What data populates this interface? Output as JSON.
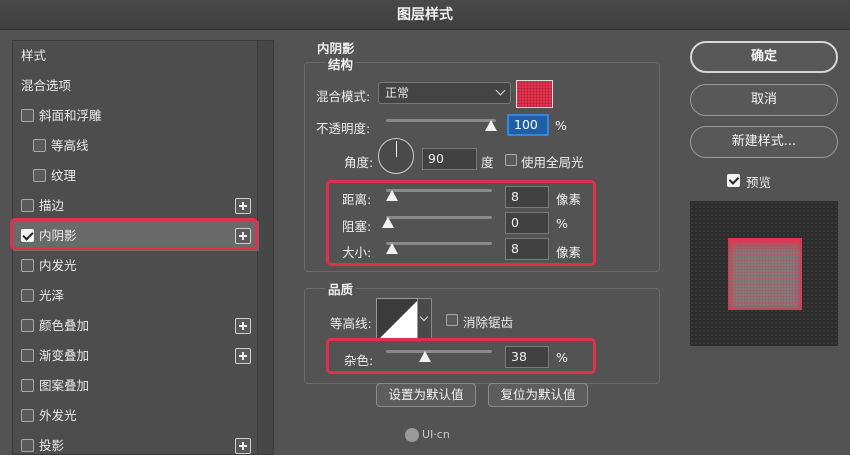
{
  "window": {
    "title": "图层样式"
  },
  "styles_list": {
    "items": [
      {
        "label": "样式",
        "checkbox": false,
        "checked": false,
        "plus": false
      },
      {
        "label": "混合选项",
        "checkbox": false,
        "checked": false,
        "plus": false
      },
      {
        "label": "斜面和浮雕",
        "checkbox": true,
        "checked": false,
        "plus": false
      },
      {
        "label": "等高线",
        "checkbox": true,
        "checked": false,
        "plus": false,
        "indent": true
      },
      {
        "label": "纹理",
        "checkbox": true,
        "checked": false,
        "plus": false,
        "indent": true
      },
      {
        "label": "描边",
        "checkbox": true,
        "checked": false,
        "plus": true
      },
      {
        "label": "内阴影",
        "checkbox": true,
        "checked": true,
        "plus": true,
        "selected": true
      },
      {
        "label": "内发光",
        "checkbox": true,
        "checked": false,
        "plus": false
      },
      {
        "label": "光泽",
        "checkbox": true,
        "checked": false,
        "plus": false
      },
      {
        "label": "颜色叠加",
        "checkbox": true,
        "checked": false,
        "plus": true
      },
      {
        "label": "渐变叠加",
        "checkbox": true,
        "checked": false,
        "plus": true
      },
      {
        "label": "图案叠加",
        "checkbox": true,
        "checked": false,
        "plus": false
      },
      {
        "label": "外发光",
        "checkbox": true,
        "checked": false,
        "plus": false
      },
      {
        "label": "投影",
        "checkbox": true,
        "checked": false,
        "plus": true
      }
    ]
  },
  "inner_shadow": {
    "section_title": "内阴影",
    "structure": {
      "title": "结构",
      "blend_mode_label": "混合模式:",
      "blend_mode_value": "正常",
      "shadow_color": "#e8314e",
      "opacity_label": "不透明度:",
      "opacity_value": "100",
      "opacity_unit": "%",
      "angle_label": "角度:",
      "angle_value": "90",
      "angle_unit": "度",
      "global_light_label": "使用全局光",
      "global_light_checked": false,
      "distance_label": "距离:",
      "distance_value": "8",
      "distance_unit": "像素",
      "choke_label": "阻塞:",
      "choke_value": "0",
      "choke_unit": "%",
      "size_label": "大小:",
      "size_value": "8",
      "size_unit": "像素"
    },
    "quality": {
      "title": "品质",
      "contour_label": "等高线:",
      "anti_alias_label": "消除锯齿",
      "anti_alias_checked": false,
      "noise_label": "杂色:",
      "noise_value": "38",
      "noise_unit": "%"
    },
    "set_default_label": "设置为默认值",
    "reset_default_label": "复位为默认值"
  },
  "actions": {
    "ok_label": "确定",
    "cancel_label": "取消",
    "new_style_label": "新建样式...",
    "preview_label": "预览",
    "preview_checked": true
  },
  "watermark": {
    "text": "UI·cn"
  },
  "colors": {
    "highlight": "#e0304a",
    "accent": "#1f5fa8"
  }
}
